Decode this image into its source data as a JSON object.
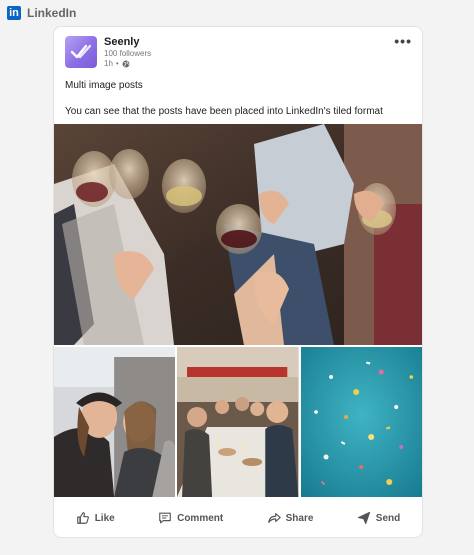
{
  "brand": {
    "name": "LinkedIn",
    "logo_text": "in",
    "color": "#0a66c2"
  },
  "post": {
    "author": "Seenly",
    "followers": "100 followers",
    "time": "1h",
    "separator": "•",
    "visibility_icon": "globe-icon",
    "more_icon": "•••",
    "text_line1": "Multi image posts",
    "text_line2": "You can see that the posts have been placed into LinkedIn's tiled format",
    "images": [
      "wine-toast-photo",
      "laughing-friends-photo",
      "restaurant-dinner-photo",
      "confetti-photo"
    ]
  },
  "actions": [
    {
      "label": "Like",
      "icon": "thumbs-up-icon"
    },
    {
      "label": "Comment",
      "icon": "comment-icon"
    },
    {
      "label": "Share",
      "icon": "share-arrow-icon"
    },
    {
      "label": "Send",
      "icon": "send-icon"
    }
  ]
}
